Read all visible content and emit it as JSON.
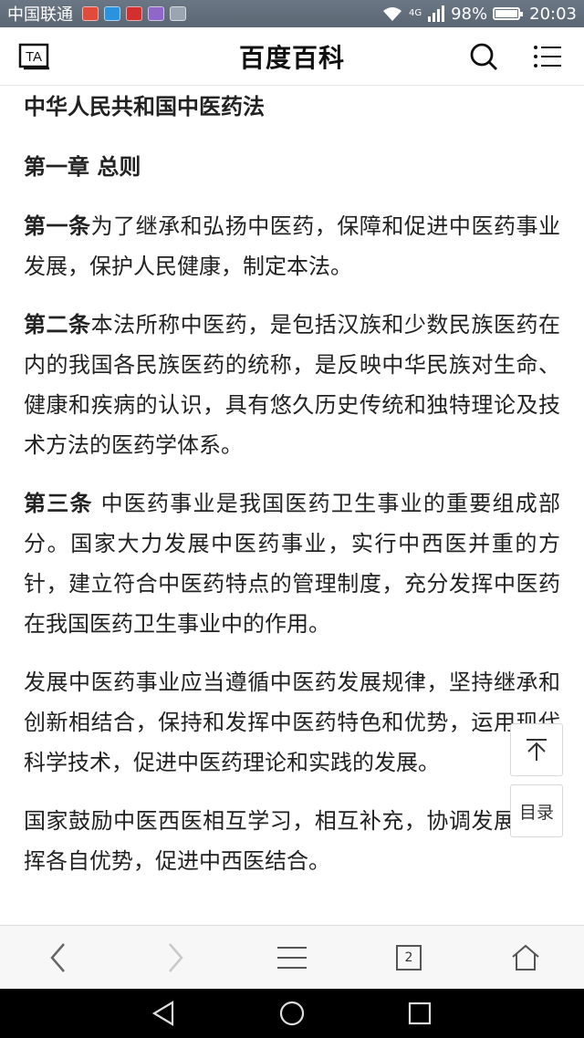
{
  "status_bar": {
    "carrier": "中国联通",
    "network_type": "4G",
    "battery_percent": "98%",
    "battery_level": 0.98,
    "time": "20:03"
  },
  "header": {
    "title": "百度百科",
    "font_icon_label": "TA"
  },
  "article": {
    "law_title": "中华人民共和国中医药法",
    "chapter": "第一章 总则",
    "articles": [
      {
        "label": "第一条",
        "text": "为了继承和弘扬中医药，保障和促进中医药事业发展，保护人民健康，制定本法。"
      },
      {
        "label": "第二条",
        "text": "本法所称中医药，是包括汉族和少数民族医药在内的我国各民族医药的统称，是反映中华民族对生命、健康和疾病的认识，具有悠久历史传统和独特理论及技术方法的医药学体系。"
      },
      {
        "label": "第三条",
        "text": " 中医药事业是我国医药卫生事业的重要组成部分。国家大力发展中医药事业，实行中西医并重的方针，建立符合中医药特点的管理制度，充分发挥中医药在我国医药卫生事业中的作用。"
      }
    ],
    "paragraphs": [
      "发展中医药事业应当遵循中医药发展规律，坚持继承和创新相结合，保持和发挥中医药特色和优势，运用现代科学技术，促进中医药理论和实践的发展。",
      "国家鼓励中医西医相互学习，相互补充，协调发展，发挥各自优势，促进中西医结合。"
    ]
  },
  "floating": {
    "toc_label": "目录"
  },
  "browser_toolbar": {
    "tab_count": "2"
  }
}
